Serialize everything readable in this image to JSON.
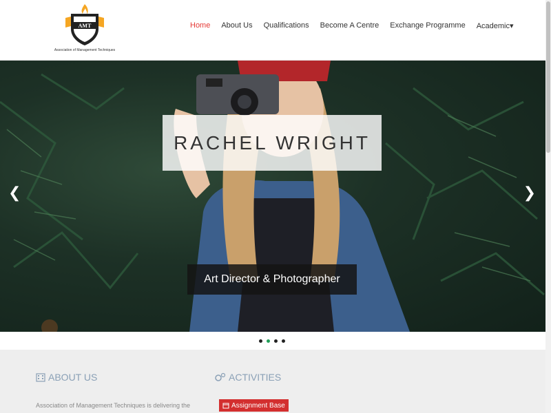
{
  "brand": {
    "logo_text": "AMT",
    "tagline": "Association of Management Techniques"
  },
  "nav": {
    "items": [
      {
        "label": "Home",
        "active": true
      },
      {
        "label": "About Us"
      },
      {
        "label": "Qualifications"
      },
      {
        "label": "Become A Centre"
      },
      {
        "label": "Exchange Programme"
      },
      {
        "label": "Academic▾"
      }
    ]
  },
  "hero": {
    "title": "RACHEL WRIGHT",
    "subtitle": "Art Director & Photographer",
    "prev_icon": "chevron-left-icon",
    "next_icon": "chevron-right-icon",
    "slide_count": 4,
    "active_slide": 2
  },
  "sections": {
    "about": {
      "heading": "ABOUT US",
      "icon": "building-icon",
      "text": "Association of Management Techniques is delivering the"
    },
    "activities": {
      "heading": "ACTIVITIES",
      "icon": "gears-icon",
      "button_label": "Assignment Base",
      "button_icon": "calendar-icon"
    }
  },
  "colors": {
    "accent": "#e53935",
    "indicator_active": "#22a05a",
    "heading": "#8aa0b6",
    "button": "#d32f2f"
  }
}
